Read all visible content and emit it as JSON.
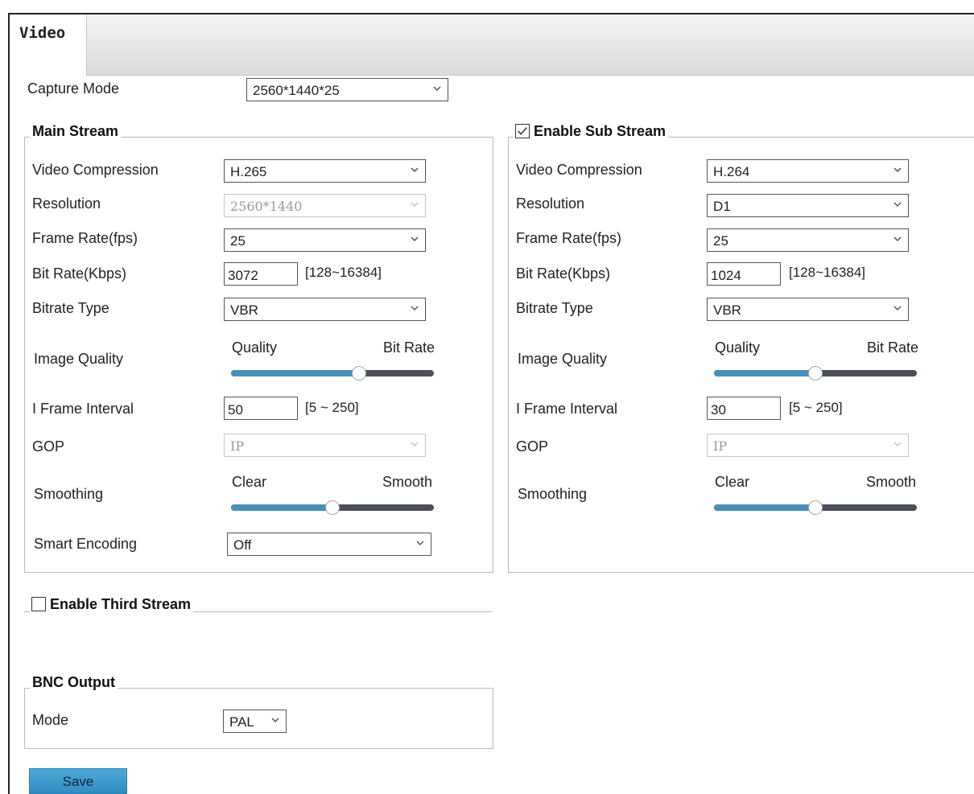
{
  "tab": {
    "label": "Video"
  },
  "capture_mode": {
    "label": "Capture Mode",
    "value": "2560*1440*25"
  },
  "main": {
    "legend": "Main Stream",
    "video_compression": {
      "label": "Video Compression",
      "value": "H.265"
    },
    "resolution": {
      "label": "Resolution",
      "value": "2560*1440"
    },
    "frame_rate": {
      "label": "Frame Rate(fps)",
      "value": "25"
    },
    "bit_rate": {
      "label": "Bit Rate(Kbps)",
      "value": "3072",
      "range": "[128~16384]"
    },
    "bitrate_type": {
      "label": "Bitrate Type",
      "value": "VBR"
    },
    "image_quality": {
      "label": "Image Quality",
      "left": "Quality",
      "right": "Bit Rate",
      "level": 0.63
    },
    "i_frame": {
      "label": "I Frame Interval",
      "value": "50",
      "range": "[5 ~ 250]"
    },
    "gop": {
      "label": "GOP",
      "value": "IP"
    },
    "smoothing": {
      "label": "Smoothing",
      "left": "Clear",
      "right": "Smooth",
      "level": 0.5
    },
    "smart_encoding": {
      "label": "Smart Encoding",
      "value": "Off"
    }
  },
  "sub": {
    "legend": "Enable Sub Stream",
    "enabled": true,
    "video_compression": {
      "label": "Video Compression",
      "value": "H.264"
    },
    "resolution": {
      "label": "Resolution",
      "value": "D1"
    },
    "frame_rate": {
      "label": "Frame Rate(fps)",
      "value": "25"
    },
    "bit_rate": {
      "label": "Bit Rate(Kbps)",
      "value": "1024",
      "range": "[128~16384]"
    },
    "bitrate_type": {
      "label": "Bitrate Type",
      "value": "VBR"
    },
    "image_quality": {
      "label": "Image Quality",
      "left": "Quality",
      "right": "Bit Rate",
      "level": 0.5
    },
    "i_frame": {
      "label": "I Frame Interval",
      "value": "30",
      "range": "[5 ~ 250]"
    },
    "gop": {
      "label": "GOP",
      "value": "IP"
    },
    "smoothing": {
      "label": "Smoothing",
      "left": "Clear",
      "right": "Smooth",
      "level": 0.5
    }
  },
  "third": {
    "legend": "Enable Third Stream",
    "enabled": false
  },
  "bnc": {
    "legend": "BNC Output",
    "mode_label": "Mode",
    "mode_value": "PAL"
  },
  "save_label": "Save",
  "colors": {
    "slider_fill": "#4a8fb8",
    "slider_track": "#4b4f5c",
    "button": "#3c9bd0"
  }
}
